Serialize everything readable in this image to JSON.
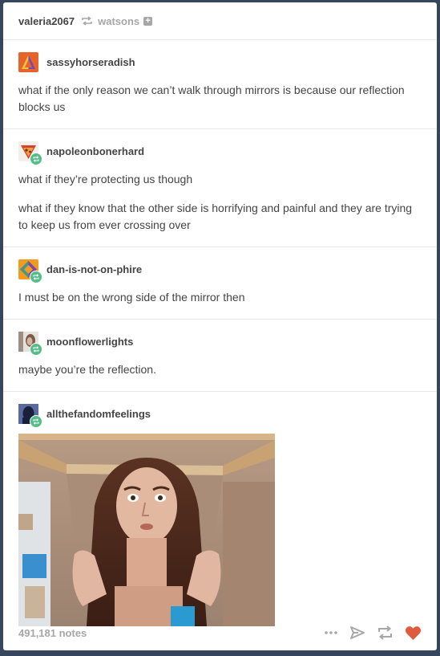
{
  "header": {
    "username": "valeria2067",
    "source": "watsons",
    "reblog_icon": "reblog-icon",
    "follow_icon": "plus-icon",
    "follow_symbol": "+"
  },
  "entries": [
    {
      "username": "sassyhorseradish",
      "avatar_colors": [
        "#e6632a",
        "#7b4aa8"
      ],
      "reblog": false,
      "paragraphs": [
        "what if the only reason we can’t walk through mirrors is because our reflection blocks us"
      ]
    },
    {
      "username": "napoleonbonerhard",
      "avatar_colors": [
        "#e9a23b",
        "#d9412b"
      ],
      "reblog": true,
      "paragraphs": [
        "what if they’re protecting us though",
        "what if they know that the other side is horrifying and painful and they are trying to keep us from ever crossing over"
      ]
    },
    {
      "username": "dan-is-not-on-phire",
      "avatar_colors": [
        "#f29b1f",
        "#7b4aa8"
      ],
      "reblog": true,
      "paragraphs": [
        "I must be on the wrong side of the mirror then"
      ]
    },
    {
      "username": "moonflowerlights",
      "avatar_colors": [
        "#cfc6c0",
        "#7a5a4a"
      ],
      "reblog": true,
      "paragraphs": [
        "maybe you’re the reflection."
      ]
    },
    {
      "username": "allthefandomfeelings",
      "avatar_colors": [
        "#2f3a6a",
        "#1a1f3a"
      ],
      "reblog": true,
      "paragraphs": []
    }
  ],
  "footer": {
    "notes": "491,181 notes",
    "icons": [
      "more-icon",
      "share-icon",
      "reblog-icon",
      "like-icon"
    ],
    "like_color": "#e25a3d",
    "reblog_badge_color": "#56bc8a"
  }
}
